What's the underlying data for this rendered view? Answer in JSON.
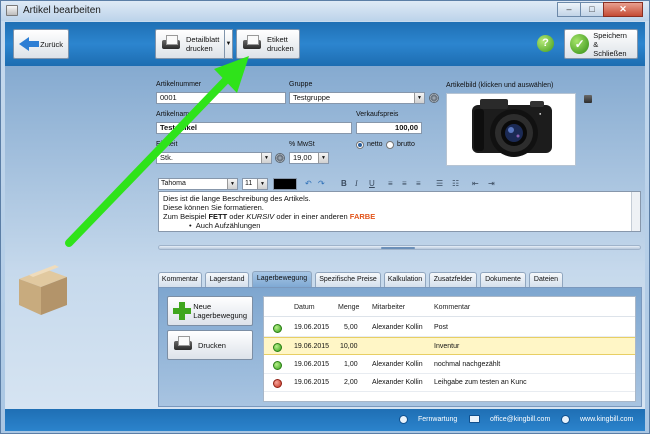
{
  "window": {
    "title": "Artikel bearbeiten",
    "minimize": "–",
    "maximize": "□",
    "close": "✕"
  },
  "toolbar": {
    "back_label": "Zurück",
    "print_detail_label_1": "Detailblatt",
    "print_detail_label_2": "drucken",
    "print_label_label_1": "Etikett",
    "print_label_label_2": "drucken",
    "help": "?",
    "save_close_label_1": "Speichern",
    "save_close_label_2": "& Schließen"
  },
  "form": {
    "artikelnummer_label": "Artikelnummer",
    "artikelnummer_value": "0001",
    "gruppe_label": "Gruppe",
    "gruppe_value": "Testgruppe",
    "artikelname_label": "Artikelname",
    "artikelname_value": "Testartikel",
    "verkaufspreis_label": "Verkaufspreis",
    "verkaufspreis_value": "100,00",
    "einheit_label": "Einheit",
    "einheit_value": "Stk.",
    "mwst_label": "% MwSt",
    "mwst_value": "19,00",
    "netto_label": "netto",
    "brutto_label": "brutto",
    "price_mode": "netto",
    "artikelbild_label": "Artikelbild (klicken und auswählen)"
  },
  "editor": {
    "font": "Tahoma",
    "size": "11",
    "line1": "Dies ist die lange Beschreibung des Artikels.",
    "line2": "Diese können Sie formatieren.",
    "line3_a": "Zum Beispiel ",
    "line3_bold": "FETT",
    "line3_b": " oder ",
    "line3_italic": "KURSIV",
    "line3_c": " oder in einer anderen ",
    "line3_colored": "FARBE",
    "line4": "Auch Aufzählungen",
    "colors": {
      "highlight": "#e2541a"
    }
  },
  "tabs": [
    "Kommentar",
    "Lagerstand",
    "Lagerbewegung",
    "Spezifische Preise",
    "Kalkulation",
    "Zusatzfelder",
    "Dokumente",
    "Dateien"
  ],
  "active_tab": "Lagerbewegung",
  "panel": {
    "new_movement_label_1": "Neue",
    "new_movement_label_2": "Lagerbewegung",
    "print_label": "Drucken"
  },
  "table": {
    "columns": [
      "Datum",
      "Menge",
      "Mitarbeiter",
      "Kommentar"
    ],
    "rows": [
      {
        "status": "green",
        "datum": "19.06.2015",
        "menge": "5,00",
        "mitarbeiter": "Alexander Kollin",
        "kommentar": "Post"
      },
      {
        "status": "green",
        "datum": "19.06.2015",
        "menge": "10,00",
        "mitarbeiter": "",
        "kommentar": "Inventur"
      },
      {
        "status": "green",
        "datum": "19.06.2015",
        "menge": "1,00",
        "mitarbeiter": "Alexander Kollin",
        "kommentar": "nochmal nachgezählt"
      },
      {
        "status": "red",
        "datum": "19.06.2015",
        "menge": "2,00",
        "mitarbeiter": "Alexander Kollin",
        "kommentar": "Leihgabe zum testen an Kunc"
      }
    ]
  },
  "footer": {
    "remote": "Fernwartung",
    "email": "office@kingbill.com",
    "web": "www.kingbill.com"
  },
  "colors": {
    "toolbar": "#2c85cf",
    "annotation_arrow": "#2fe31a"
  }
}
